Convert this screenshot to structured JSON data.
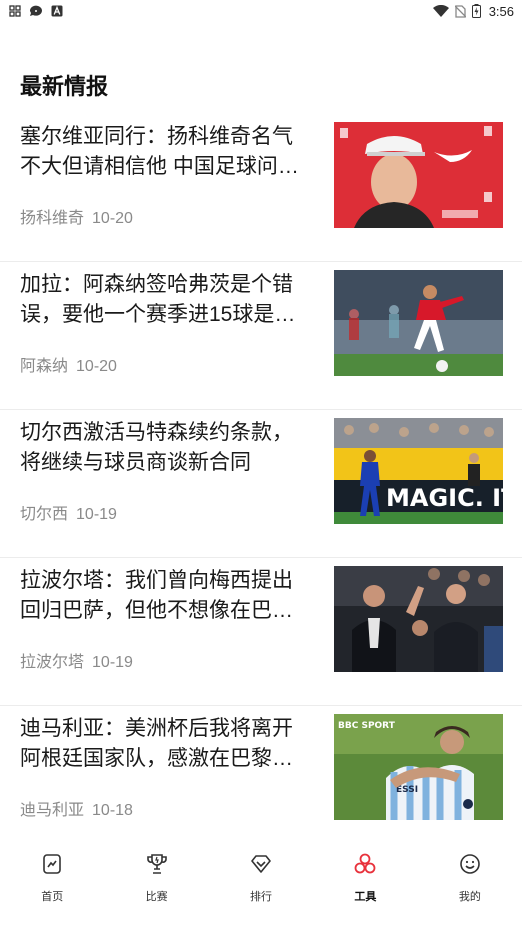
{
  "status_bar": {
    "time": "3:56"
  },
  "section_title": "最新情报",
  "news": [
    {
      "title": "塞尔维亚同行：扬科维奇名气不大但请相信他 中国足球问…",
      "tag": "扬科维奇",
      "date": "10-20",
      "image": "coach-portrait"
    },
    {
      "title": "加拉：阿森纳签哈弗茨是个错误，要他一个赛季进15球是…",
      "tag": "阿森纳",
      "date": "10-20",
      "image": "arsenal-player-running"
    },
    {
      "title": "切尔西激活马特森续约条款，将继续与球员商谈新合同",
      "tag": "切尔西",
      "date": "10-19",
      "image": "chelsea-player-magic-board",
      "board_text": "MAGIC. IT"
    },
    {
      "title": "拉波尔塔：我们曾向梅西提出回归巴萨，但他不想像在巴…",
      "tag": "拉波尔塔",
      "date": "10-19",
      "image": "laporta-stands"
    },
    {
      "title": "迪马利亚：美洲杯后我将离开阿根廷国家队，感激在巴黎…",
      "tag": "迪马利亚",
      "date": "10-18",
      "image": "messi-dimaria-hug",
      "overlay": "BBC SPORT"
    }
  ],
  "nav": [
    {
      "label": "首页",
      "icon": "home-chart-icon",
      "active": false
    },
    {
      "label": "比赛",
      "icon": "trophy-icon",
      "active": false
    },
    {
      "label": "排行",
      "icon": "diamond-badge-icon",
      "active": false
    },
    {
      "label": "工具",
      "icon": "tools-circles-icon",
      "active": true
    },
    {
      "label": "我的",
      "icon": "smiley-icon",
      "active": false
    }
  ],
  "colors": {
    "accent": "#e8323c",
    "text": "#1a1a1a",
    "meta": "#8a8a8a"
  }
}
